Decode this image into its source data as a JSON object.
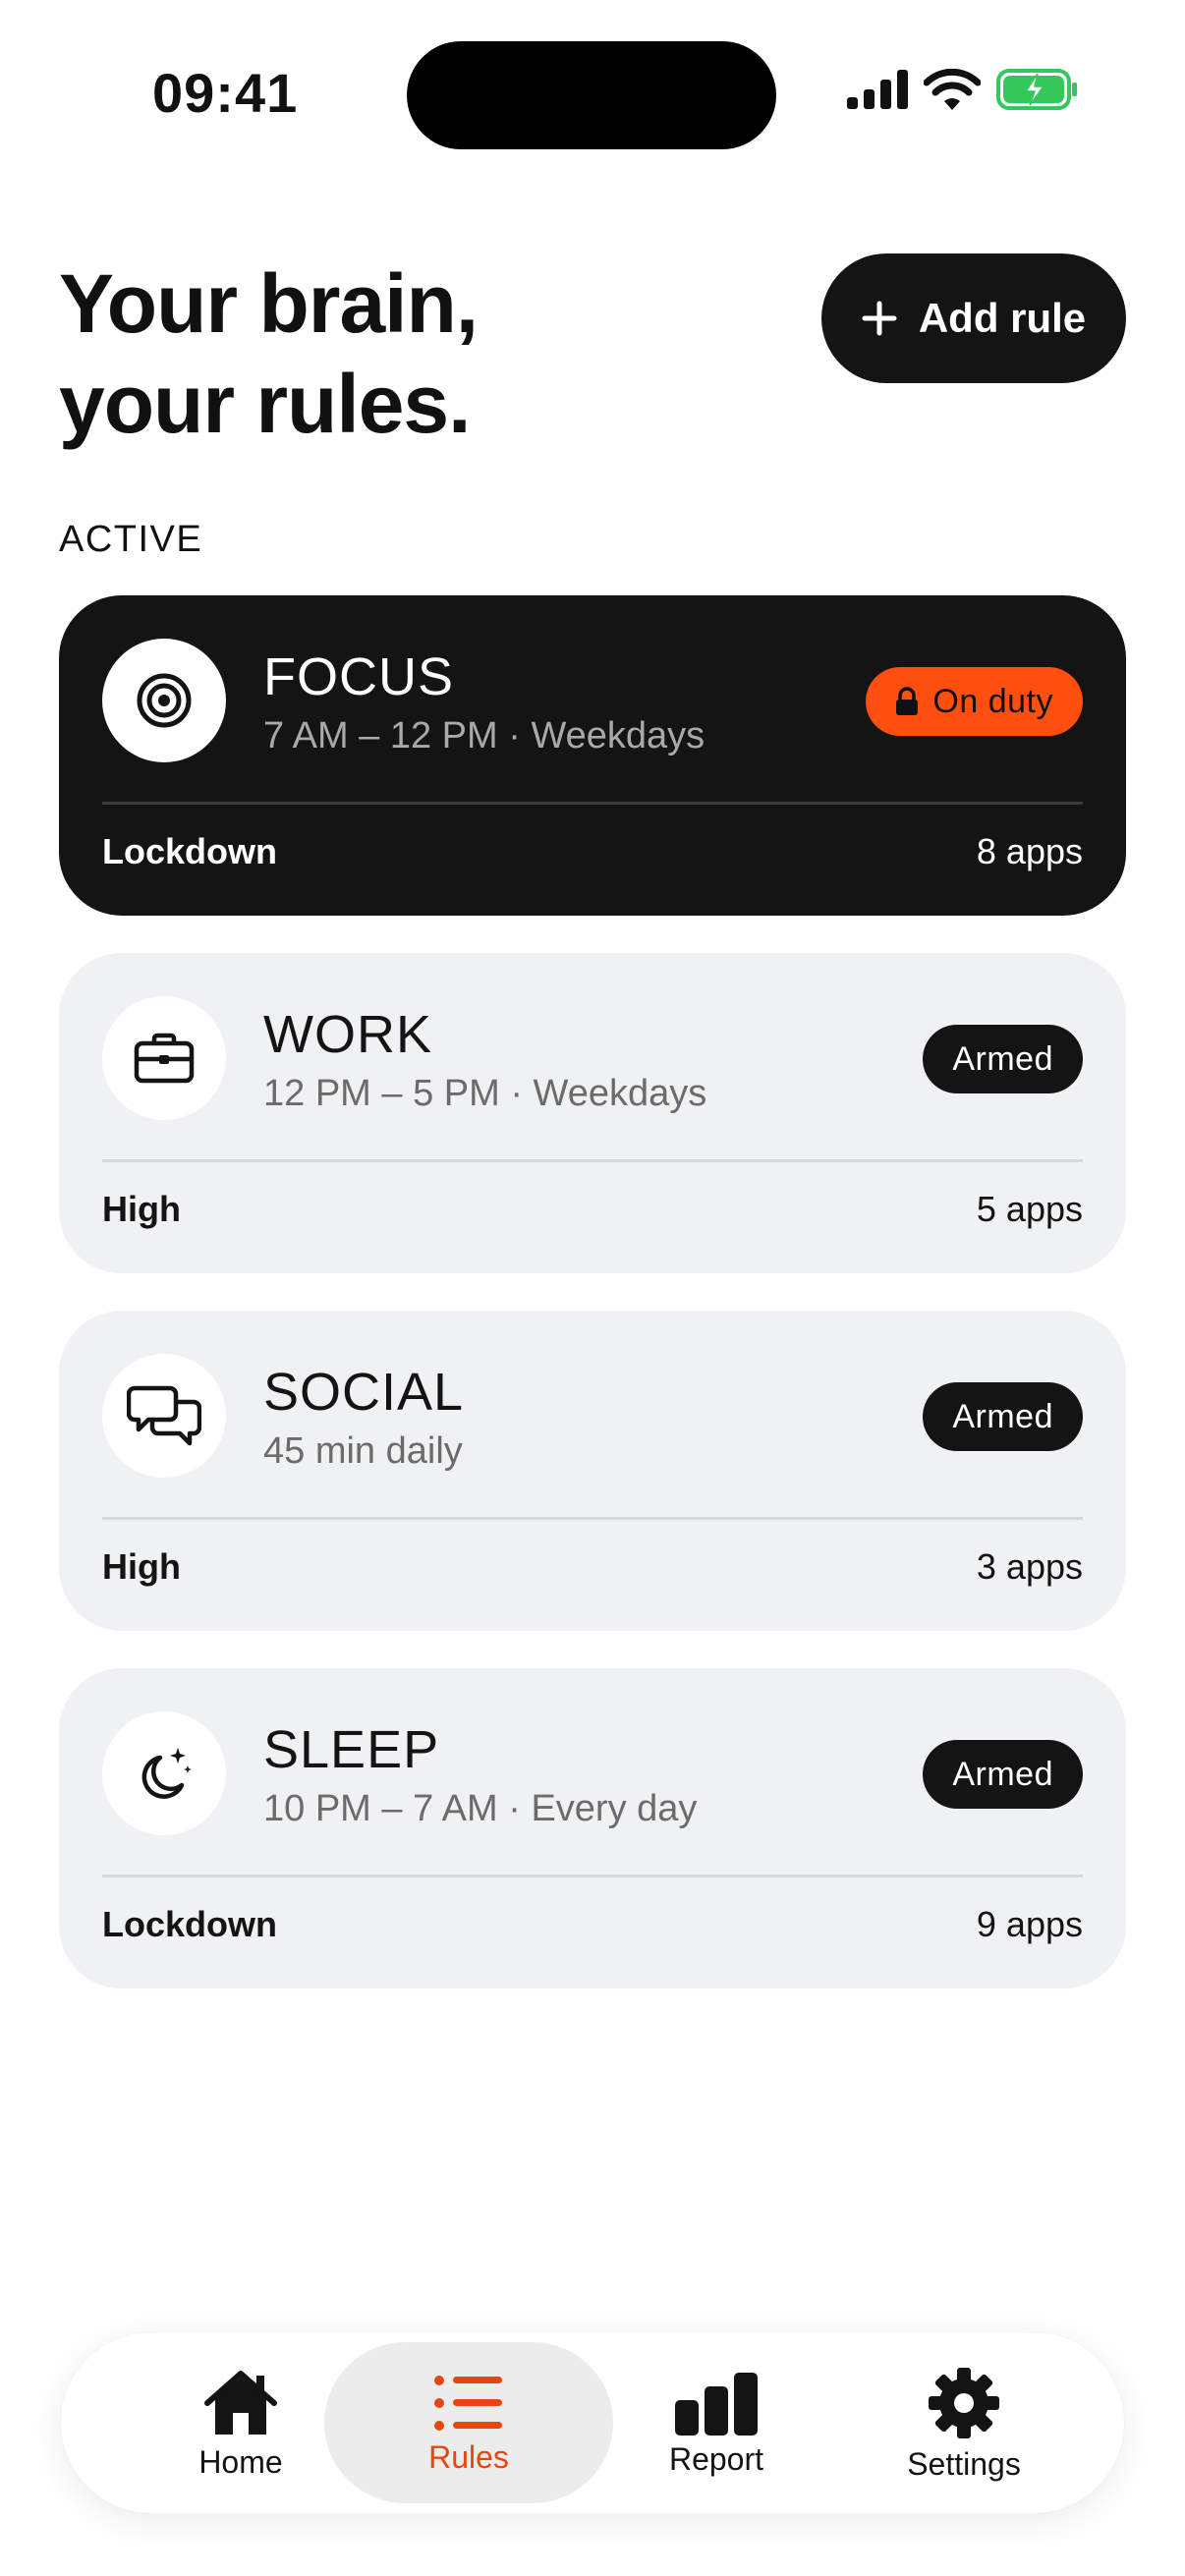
{
  "status": {
    "time": "09:41"
  },
  "header": {
    "title_line1": "Your brain,",
    "title_line2": "your rules.",
    "add_button_label": "Add rule"
  },
  "section": {
    "label": "ACTIVE"
  },
  "rules": [
    {
      "name": "FOCUS",
      "schedule": "7 AM – 12 PM · Weekdays",
      "status": "On duty",
      "level": "Lockdown",
      "apps": "8 apps",
      "icon": "target-icon"
    },
    {
      "name": "WORK",
      "schedule": "12 PM – 5 PM · Weekdays",
      "status": "Armed",
      "level": "High",
      "apps": "5 apps",
      "icon": "briefcase-icon"
    },
    {
      "name": "SOCIAL",
      "schedule": "45 min daily",
      "status": "Armed",
      "level": "High",
      "apps": "3 apps",
      "icon": "chat-bubbles-icon"
    },
    {
      "name": "SLEEP",
      "schedule": "10 PM – 7 AM · Every day",
      "status": "Armed",
      "level": "Lockdown",
      "apps": "9 apps",
      "icon": "moon-stars-icon"
    }
  ],
  "nav": {
    "items": [
      {
        "label": "Home",
        "icon": "home-icon"
      },
      {
        "label": "Rules",
        "icon": "list-icon",
        "active": true
      },
      {
        "label": "Report",
        "icon": "bar-chart-icon"
      },
      {
        "label": "Settings",
        "icon": "gear-icon"
      }
    ]
  },
  "colors": {
    "accent": "#ff4f0e",
    "active_nav": "#e6470f",
    "dark_card": "#141414",
    "light_card": "#f0f1f2",
    "battery": "#34c759"
  }
}
